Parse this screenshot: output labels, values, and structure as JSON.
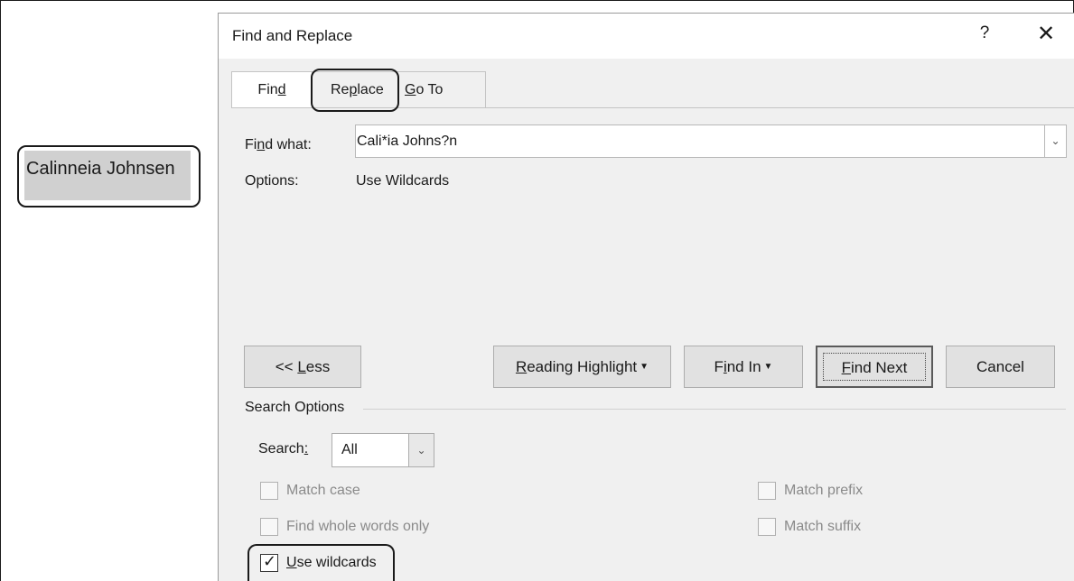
{
  "document": {
    "selected_text": "Calinneia Johnsen"
  },
  "dialog": {
    "title": "Find and Replace",
    "help": "?",
    "close": "✕",
    "tabs": [
      {
        "label_pre": "Fin",
        "mnemonic": "d",
        "label_post": ""
      },
      {
        "label_pre": "Re",
        "mnemonic": "p",
        "label_post": "lace"
      },
      {
        "label_pre": "",
        "mnemonic": "G",
        "label_post": "o To"
      }
    ],
    "find_what": {
      "label_pre": "Fi",
      "mnemonic": "n",
      "label_post": "d what:",
      "value": "Cali*ia Johns?n"
    },
    "options": {
      "label": "Options:",
      "value": "Use Wildcards"
    },
    "buttons": {
      "less": {
        "pre": "<< ",
        "mnemonic": "L",
        "post": "ess"
      },
      "reading": {
        "pre": "",
        "mnemonic": "R",
        "post": "eading Highlight"
      },
      "find_in": {
        "pre": "F",
        "mnemonic": "i",
        "post": "nd In"
      },
      "find_next": {
        "pre": "",
        "mnemonic": "F",
        "post": "ind Next"
      },
      "cancel": "Cancel"
    },
    "search_options": {
      "section_label": "Search Options",
      "search_label_pre": "Search",
      "search_mnemonic": ":",
      "search_value": "All",
      "checkboxes": {
        "match_case": {
          "label": "Match case",
          "checked": false
        },
        "whole_words": {
          "label": "Find whole words only",
          "checked": false
        },
        "match_prefix": {
          "label": "Match prefix",
          "checked": false
        },
        "match_suffix": {
          "label": "Match suffix",
          "checked": false
        },
        "use_wildcards": {
          "mnemonic": "U",
          "label_post": "se wildcards",
          "checked": true
        }
      }
    }
  }
}
